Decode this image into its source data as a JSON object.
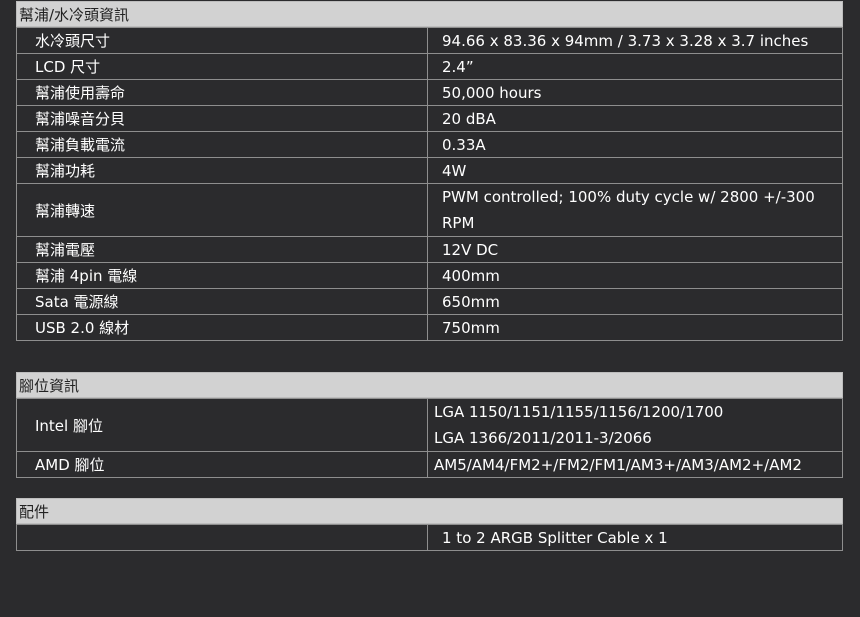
{
  "pump_section": {
    "title": "幫浦/水冷頭資訊",
    "rows": [
      {
        "label": "水冷頭尺寸",
        "value": "94.66 x 83.36 x 94mm / 3.73 x 3.28 x 3.7 inches"
      },
      {
        "label": "LCD 尺寸",
        "value": "2.4”"
      },
      {
        "label": "幫浦使用壽命",
        "value": "50,000 hours"
      },
      {
        "label": "幫浦噪音分貝",
        "value": "20 dBA"
      },
      {
        "label": "幫浦負載電流",
        "value": "0.33A"
      },
      {
        "label": "幫浦功耗",
        "value": "4W"
      },
      {
        "label": "幫浦轉速",
        "value": "PWM controlled; 100% duty cycle w/ 2800 +/-300 RPM"
      },
      {
        "label": "幫浦電壓",
        "value": "12V DC"
      },
      {
        "label": "幫浦 4pin 電線",
        "value": "400mm"
      },
      {
        "label": "Sata 電源線",
        "value": "650mm"
      },
      {
        "label": "USB 2.0 線材",
        "value": "750mm"
      }
    ]
  },
  "socket_section": {
    "title": "腳位資訊",
    "intel": {
      "label": "Intel 腳位",
      "line1": "LGA 1150/1151/1155/1156/1200/1700",
      "line2": "LGA 1366/2011/2011-3/2066"
    },
    "amd": {
      "label": "AMD 腳位",
      "value": "AM5/AM4/FM2+/FM2/FM1/AM3+/AM3/AM2+/AM2"
    }
  },
  "accessory_section": {
    "title": "配件",
    "rows": [
      {
        "label": "",
        "value": "1 to 2 ARGB Splitter Cable x 1"
      }
    ]
  }
}
